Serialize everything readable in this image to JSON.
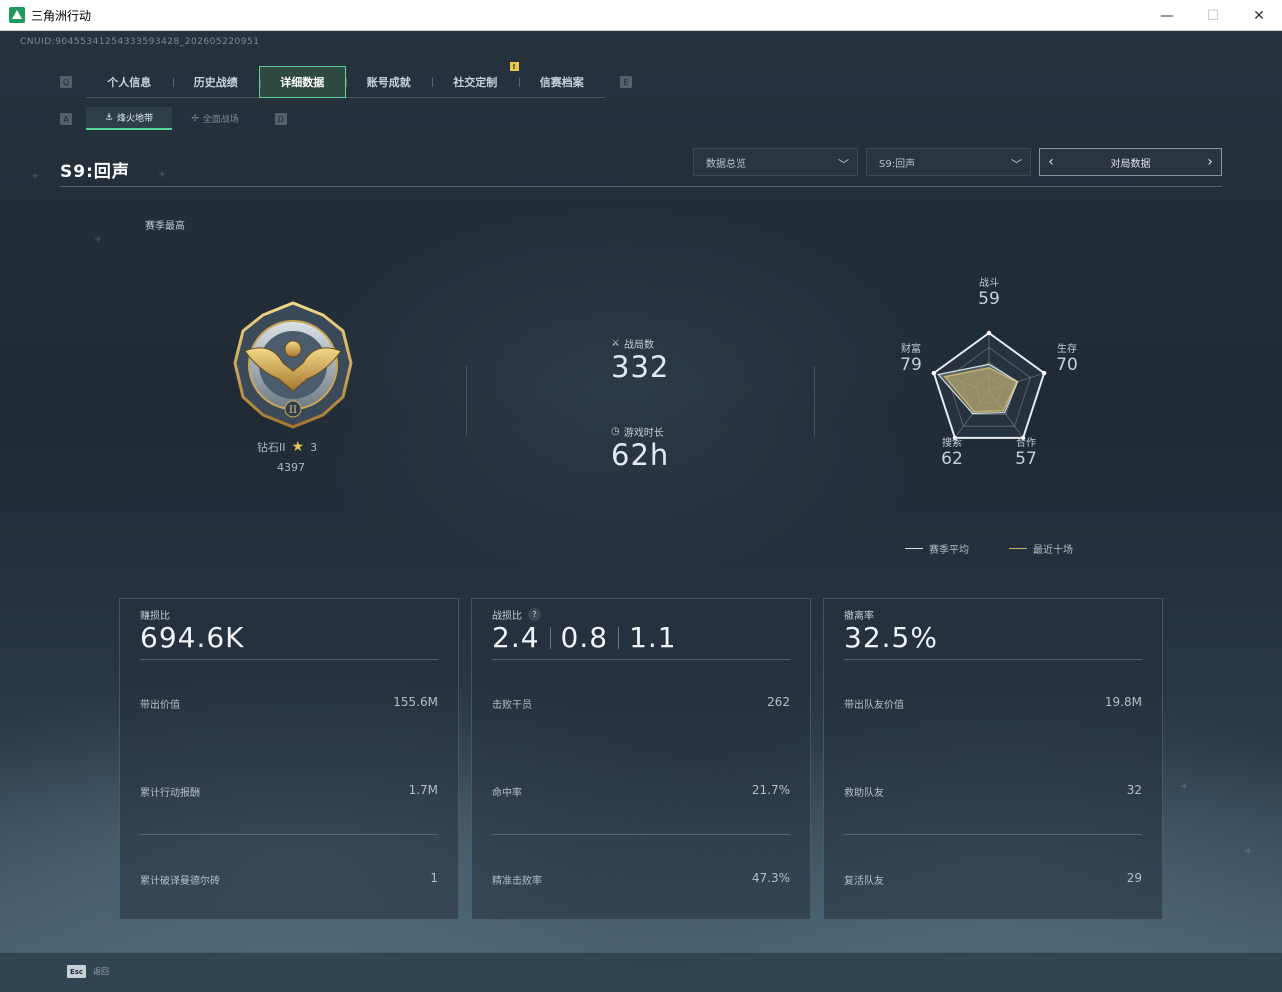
{
  "window": {
    "title": "三角洲行动",
    "minimize": "—",
    "maximize": "☐",
    "close": "✕"
  },
  "uid": "CNUID:904553412543335934​28_202605220951",
  "tabs": [
    {
      "label": "个人信息",
      "active": false
    },
    {
      "label": "历史战绩",
      "active": false
    },
    {
      "label": "详细数据",
      "active": true
    },
    {
      "label": "账号成就",
      "active": false
    },
    {
      "label": "社交定制",
      "active": false
    },
    {
      "label": "信赛档案",
      "active": false
    }
  ],
  "tab_badge": "!",
  "key_hints": {
    "q": "Q",
    "e": "E",
    "a": "A",
    "d": "D"
  },
  "subtabs": [
    {
      "label": "烽火地带",
      "active": true
    },
    {
      "label": "全面战场",
      "active": false
    }
  ],
  "season_title": "S9:回声",
  "dropdowns": {
    "overview": "数据总览",
    "season": "S9:回声"
  },
  "pager": {
    "label": "对局数据",
    "prev": "‹",
    "next": "›"
  },
  "season_best": "赛季最高",
  "rank": {
    "name": "钻石II",
    "stars": "3",
    "score": "4397"
  },
  "stats": {
    "matches_label": "战局数",
    "matches_value": "332",
    "playtime_label": "游戏时长",
    "playtime_value": "62h"
  },
  "radar": {
    "axes": [
      {
        "label": "战斗",
        "value": "59"
      },
      {
        "label": "生存",
        "value": "70"
      },
      {
        "label": "合作",
        "value": "57"
      },
      {
        "label": "搜索",
        "value": "62"
      },
      {
        "label": "财富",
        "value": "79"
      }
    ],
    "season_avg": [
      0.46,
      0.52,
      0.46,
      0.48,
      0.92
    ],
    "recent_ten": [
      0.4,
      0.5,
      0.42,
      0.44,
      0.8
    ],
    "colors": {
      "season_avg": "#d9dfe3",
      "recent_ten": "#c9b46a"
    }
  },
  "legend": {
    "season_avg": "赛季平均",
    "recent_ten": "最近十场"
  },
  "cards": [
    {
      "title": "赚损比",
      "big": [
        "694.6K"
      ],
      "rows": [
        {
          "label": "带出价值",
          "value": "155.6M"
        },
        {
          "label": "累计行动报酬",
          "value": "1.7M"
        },
        {
          "label": "累计破译曼德尔砖",
          "value": "1"
        }
      ]
    },
    {
      "title": "战损比",
      "big": [
        "2.4",
        "0.8",
        "1.1"
      ],
      "help": "?",
      "rows": [
        {
          "label": "击败干员",
          "value": "262"
        },
        {
          "label": "命中率",
          "value": "21.7%"
        },
        {
          "label": "精准击败率",
          "value": "47.3%"
        }
      ]
    },
    {
      "title": "撤离率",
      "big": [
        "32.5%"
      ],
      "rows": [
        {
          "label": "带出队友价值",
          "value": "19.8M"
        },
        {
          "label": "救助队友",
          "value": "32"
        },
        {
          "label": "复活队友",
          "value": "29"
        }
      ]
    }
  ],
  "footer": {
    "esc_key": "Esc",
    "esc_label": "返回"
  },
  "colors": {
    "accent": "#58d29a",
    "gold": "#e3c257"
  }
}
